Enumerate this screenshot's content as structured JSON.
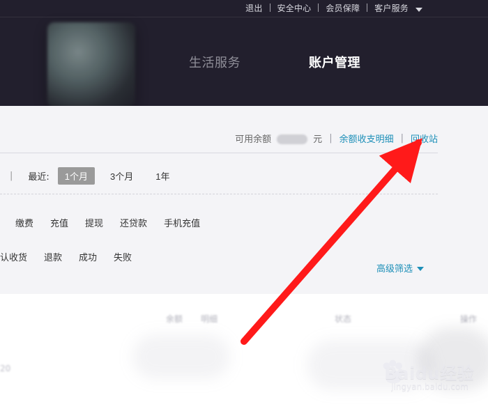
{
  "header": {
    "top_links": [
      {
        "label": "退出"
      },
      {
        "label": "安全中心"
      },
      {
        "label": "会员保障"
      },
      {
        "label": "客户服务"
      }
    ],
    "nav": [
      {
        "label": "生活服务",
        "state": "inactive"
      },
      {
        "label": "账户管理",
        "state": "active"
      }
    ]
  },
  "account": {
    "balance_label": "可用余额",
    "balance_unit": "元",
    "links": {
      "details": "余额收支明细",
      "recycle": "回收站"
    }
  },
  "filters": {
    "recent_label": "最近:",
    "ranges": [
      {
        "label": "1个月",
        "selected": true
      },
      {
        "label": "3个月",
        "selected": false
      },
      {
        "label": "1年",
        "selected": false
      }
    ],
    "types": [
      "缴费",
      "充值",
      "提现",
      "还贷款",
      "手机充值"
    ],
    "statuses": [
      "认收货",
      "退款",
      "成功",
      "失败"
    ],
    "advanced": "高级筛选"
  },
  "table": {
    "header_blurred": [
      "余额",
      "明细",
      "状态",
      "操作"
    ],
    "left_blurred_text": "20"
  },
  "watermark": {
    "main": "Baidu经验",
    "sub": "jingyan.baidu.com"
  },
  "colors": {
    "header_bg": "#221f2d",
    "content_bg": "#f4f4f7",
    "link_blue": "#1d8fb8",
    "arrow_red": "#ff1a1a"
  },
  "icons": {
    "dropdown": "chevron-down-icon",
    "arrow": "arrow-icon",
    "paw": "paw-icon"
  }
}
